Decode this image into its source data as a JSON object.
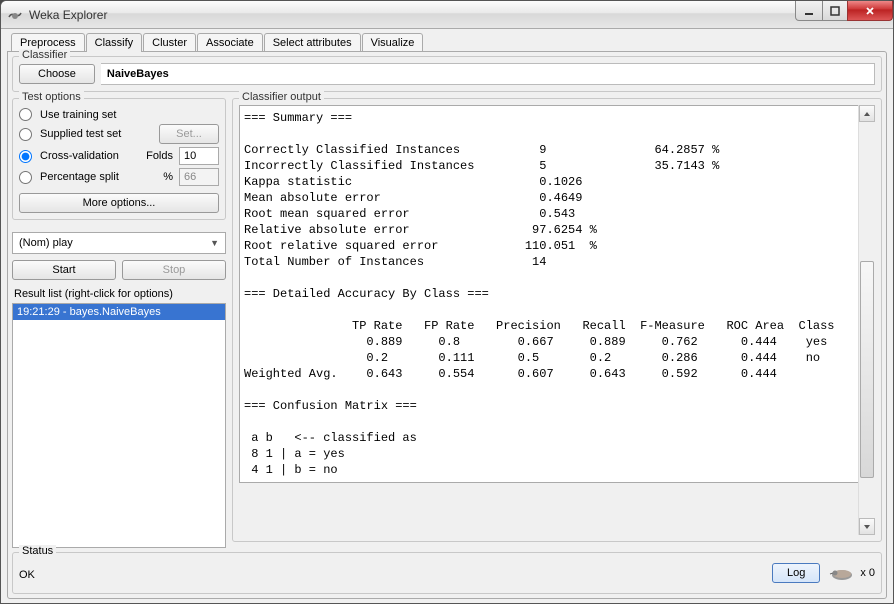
{
  "window": {
    "title": "Weka Explorer"
  },
  "tabs": [
    "Preprocess",
    "Classify",
    "Cluster",
    "Associate",
    "Select attributes",
    "Visualize"
  ],
  "active_tab": "Classify",
  "classifier": {
    "legend": "Classifier",
    "choose_label": "Choose",
    "name": "NaiveBayes"
  },
  "test_options": {
    "legend": "Test options",
    "use_training_set": "Use training set",
    "supplied_test_set": "Supplied test set",
    "set_label": "Set...",
    "cross_validation": "Cross-validation",
    "folds_label": "Folds",
    "folds_value": "10",
    "percentage_split": "Percentage split",
    "percent_label": "%",
    "percent_value": "66",
    "more_options": "More options...",
    "selected_option": "cross_validation"
  },
  "class_combo": "(Nom) play",
  "start_label": "Start",
  "stop_label": "Stop",
  "result_list_label": "Result list (right-click for options)",
  "result_items": [
    "19:21:29 - bayes.NaiveBayes"
  ],
  "output_legend": "Classifier output",
  "output_text": "=== Summary ===\n\nCorrectly Classified Instances           9               64.2857 %\nIncorrectly Classified Instances         5               35.7143 %\nKappa statistic                          0.1026\nMean absolute error                      0.4649\nRoot mean squared error                  0.543 \nRelative absolute error                 97.6254 %\nRoot relative squared error            110.051  %\nTotal Number of Instances               14     \n\n=== Detailed Accuracy By Class ===\n\n               TP Rate   FP Rate   Precision   Recall  F-Measure   ROC Area  Class\n                 0.889     0.8        0.667     0.889     0.762      0.444    yes\n                 0.2       0.111      0.5       0.2       0.286      0.444    no\nWeighted Avg.    0.643     0.554      0.607     0.643     0.592      0.444\n\n=== Confusion Matrix ===\n\n a b   <-- classified as\n 8 1 | a = yes\n 4 1 | b = no\n",
  "status": {
    "legend": "Status",
    "text": "OK",
    "log_label": "Log",
    "counter": "x 0"
  }
}
